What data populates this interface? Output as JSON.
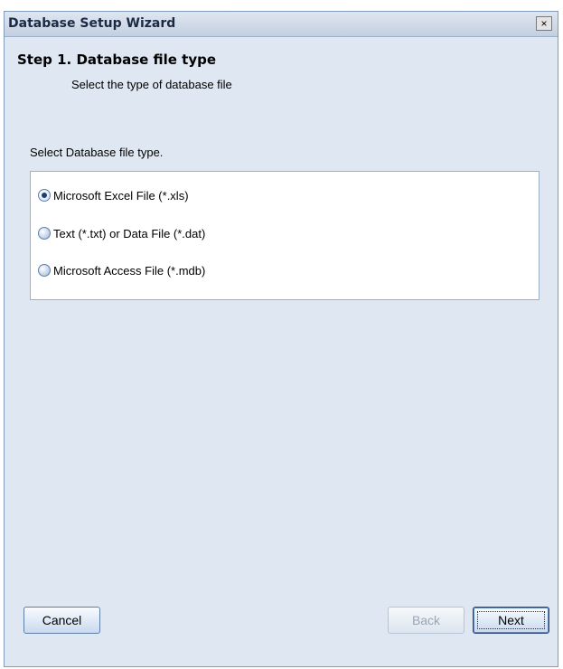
{
  "window": {
    "title": "Database Setup Wizard",
    "close_glyph": "×"
  },
  "header": {
    "step_title": "Step 1. Database file type",
    "step_subtitle": "Select the type of database file"
  },
  "prompt": "Select Database file type.",
  "options": [
    {
      "label": "Microsoft Excel File (*.xls)",
      "selected": true
    },
    {
      "label": "Text (*.txt) or Data File (*.dat)",
      "selected": false
    },
    {
      "label": "Microsoft Access File (*.mdb)",
      "selected": false
    }
  ],
  "buttons": {
    "cancel": "Cancel",
    "back": "Back",
    "next": "Next"
  }
}
